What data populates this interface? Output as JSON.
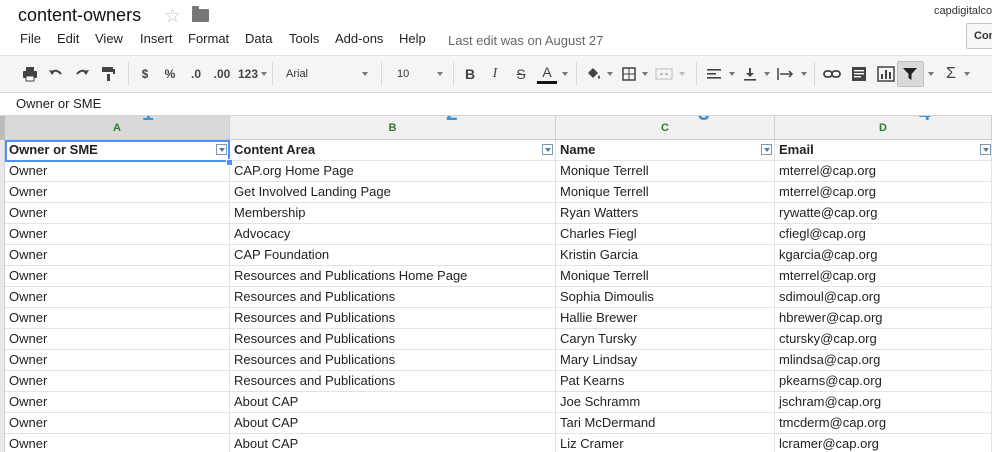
{
  "window": {
    "title": "content-owners",
    "account": "capdigitalco",
    "comments_label": "Comments"
  },
  "menu": [
    "File",
    "Edit",
    "View",
    "Insert",
    "Format",
    "Data",
    "Tools",
    "Add-ons",
    "Help"
  ],
  "last_edit": "Last edit was on August 27",
  "toolbar": {
    "currency": "$",
    "percent": "%",
    "dec_less": ".0",
    "dec_more": ".00",
    "more_formats": "123",
    "font": "Arial",
    "font_size": "10",
    "bold": "B",
    "italic": "I",
    "strike": "S",
    "text_color": "A",
    "sum": "Σ"
  },
  "icons": [
    "star-icon",
    "folder-icon",
    "print-icon",
    "undo-icon",
    "redo-icon",
    "paint-format-icon",
    "fill-color-icon",
    "borders-icon",
    "merge-icon",
    "align-left-icon",
    "valign-bottom-icon",
    "wrap-icon",
    "link-icon",
    "comment-icon",
    "chart-icon",
    "filter-icon",
    "functions-icon"
  ],
  "formula_bar": {
    "value": "Owner or SME"
  },
  "colors": {
    "accent": "#4d90fe",
    "header_text": "#2d7d2d",
    "annotation": "#3a93d8"
  },
  "columns": [
    {
      "letter": "A",
      "annotation": "1"
    },
    {
      "letter": "B",
      "annotation": "2"
    },
    {
      "letter": "C",
      "annotation": "3"
    },
    {
      "letter": "D",
      "annotation": "4"
    }
  ],
  "table": {
    "headers": [
      "Owner or SME",
      "Content Area",
      "Name",
      "Email"
    ],
    "rows": [
      [
        "Owner",
        "CAP.org Home Page",
        "Monique Terrell",
        "mterrel@cap.org"
      ],
      [
        "Owner",
        "Get Involved Landing Page",
        "Monique Terrell",
        "mterrel@cap.org"
      ],
      [
        "Owner",
        "Membership",
        "Ryan Watters",
        "rywatte@cap.org"
      ],
      [
        "Owner",
        "Advocacy",
        "Charles Fiegl",
        "cfiegl@cap.org"
      ],
      [
        "Owner",
        "CAP Foundation",
        "Kristin Garcia",
        "kgarcia@cap.org"
      ],
      [
        "Owner",
        "Resources and Publications Home Page",
        "Monique Terrell",
        "mterrel@cap.org"
      ],
      [
        "Owner",
        "Resources and Publications",
        "Sophia Dimoulis",
        "sdimoul@cap.org"
      ],
      [
        "Owner",
        "Resources and Publications",
        "Hallie Brewer",
        "hbrewer@cap.org"
      ],
      [
        "Owner",
        "Resources and Publications",
        "Caryn Tursky",
        "ctursky@cap.org"
      ],
      [
        "Owner",
        "Resources and Publications",
        "Mary Lindsay",
        "mlindsa@cap.org"
      ],
      [
        "Owner",
        "Resources and Publications",
        "Pat Kearns",
        "pkearns@cap.org"
      ],
      [
        "Owner",
        "About CAP",
        "Joe Schramm",
        "jschram@cap.org"
      ],
      [
        "Owner",
        "About CAP",
        "Tari McDermand",
        "tmcderm@cap.org"
      ],
      [
        "Owner",
        "About CAP",
        "Liz Cramer",
        "lcramer@cap.org"
      ]
    ]
  }
}
